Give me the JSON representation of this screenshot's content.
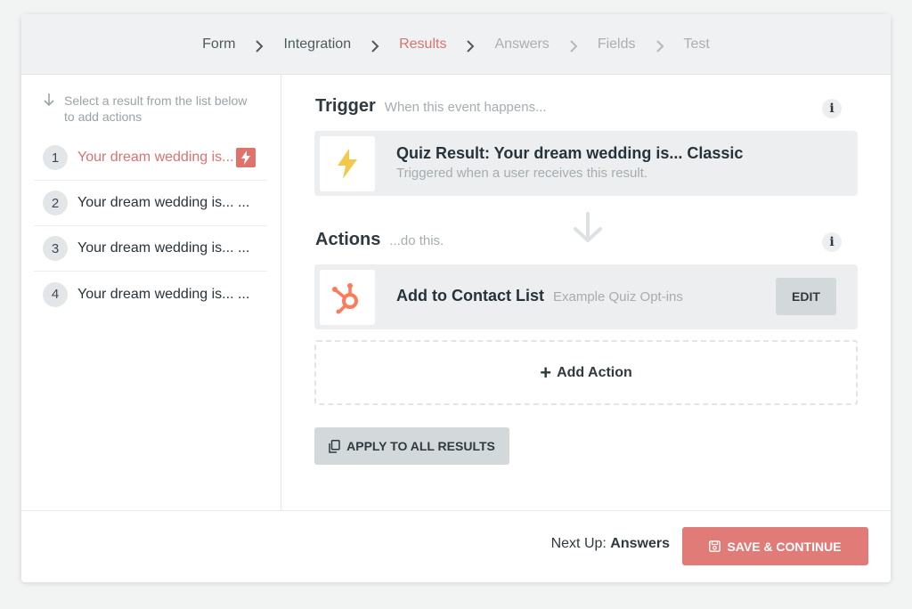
{
  "stepper": {
    "steps": [
      {
        "label": "Form",
        "state": "done"
      },
      {
        "label": "Integration",
        "state": "done"
      },
      {
        "label": "Results",
        "state": "active"
      },
      {
        "label": "Answers",
        "state": "future"
      },
      {
        "label": "Fields",
        "state": "future"
      },
      {
        "label": "Test",
        "state": "future"
      }
    ]
  },
  "sidebar": {
    "hint": "Select a result from the list below to add actions",
    "results": [
      {
        "num": "1",
        "label": "Your dream wedding is...",
        "active": true
      },
      {
        "num": "2",
        "label": "Your dream wedding is... ...",
        "active": false
      },
      {
        "num": "3",
        "label": "Your dream wedding is... ...",
        "active": false
      },
      {
        "num": "4",
        "label": "Your dream wedding is... ...",
        "active": false
      }
    ]
  },
  "trigger": {
    "title": "Trigger",
    "subtitle": "When this event happens...",
    "event_title": "Quiz Result: Your dream wedding is... Classic",
    "event_desc": "Triggered when a user receives this result."
  },
  "actions": {
    "title": "Actions",
    "subtitle": "...do this.",
    "item_title": "Add to Contact List",
    "item_detail": "Example Quiz Opt-ins",
    "edit_label": "EDIT",
    "add_label": "Add Action",
    "apply_label": "APPLY TO ALL RESULTS"
  },
  "footer": {
    "next_prefix": "Next Up:",
    "next_value": "Answers",
    "save_label": "SAVE & CONTINUE"
  },
  "colors": {
    "accent": "#e07b77",
    "hubspot": "#ff7a59",
    "bolt": "#f2c94c"
  }
}
